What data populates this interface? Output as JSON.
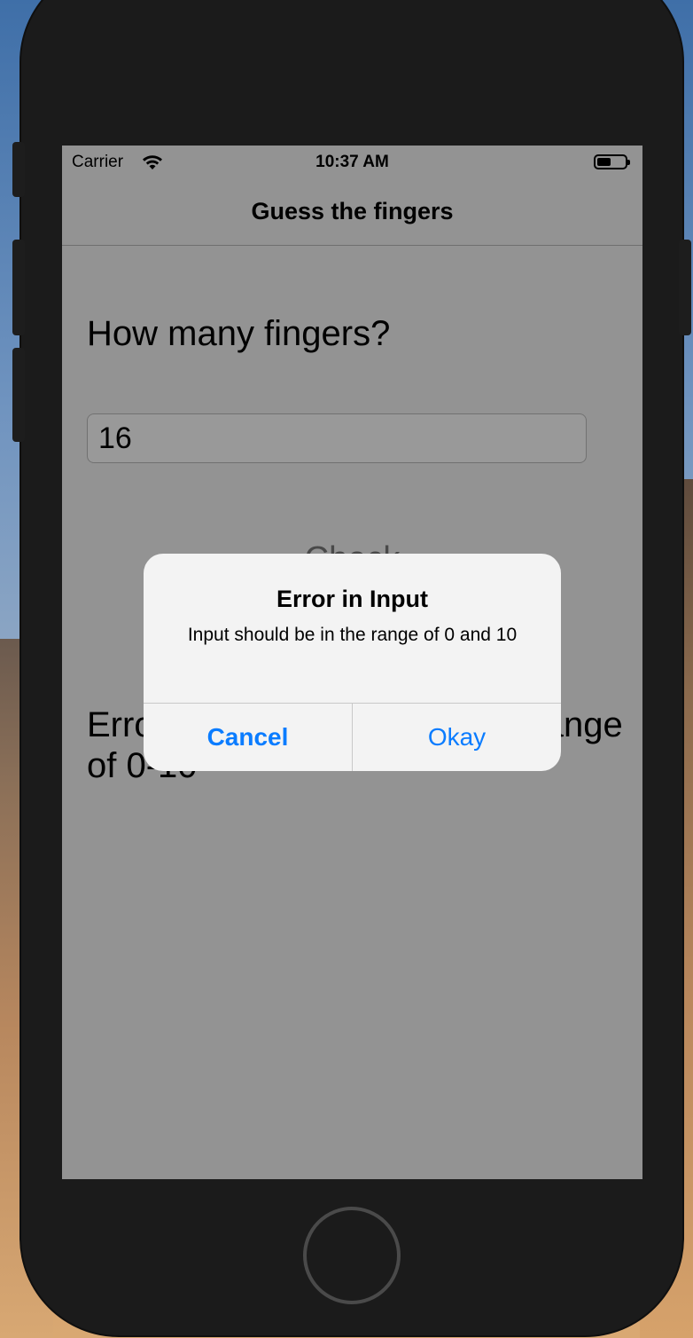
{
  "status_bar": {
    "carrier": "Carrier",
    "time": "10:37 AM",
    "wifi_icon": "wifi-icon",
    "battery_icon": "battery-icon",
    "battery_level": 0.5
  },
  "nav_bar": {
    "title": "Guess the fingers"
  },
  "main": {
    "question": "How many fingers?",
    "input_value": "16",
    "check_button": "Check",
    "result_text": "Error: enter a number in the range of 0-10"
  },
  "alert": {
    "title": "Error in Input",
    "message": "Input should be in the range of 0 and 10",
    "cancel_label": "Cancel",
    "okay_label": "Okay",
    "button_color": "#0a7cff"
  }
}
